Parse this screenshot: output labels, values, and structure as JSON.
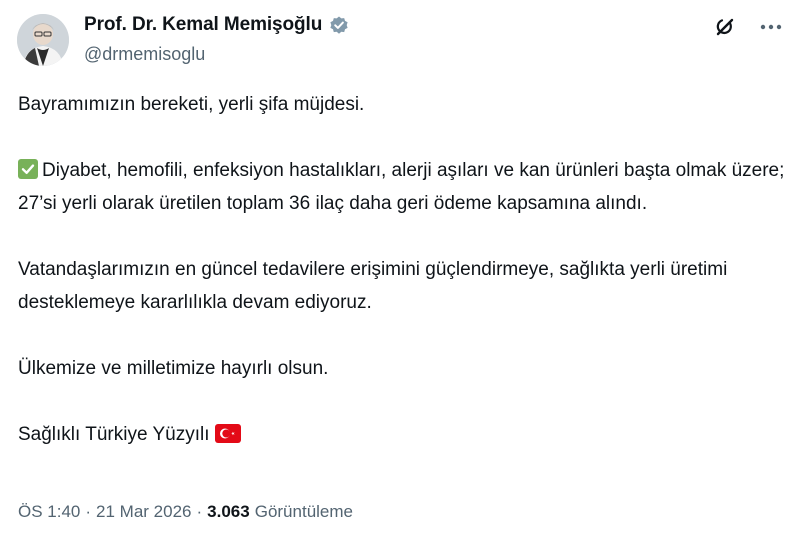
{
  "author": {
    "display_name": "Prof. Dr. Kemal Memişoğlu",
    "handle": "@drmemisoglu",
    "verified": true
  },
  "icons": {
    "avatar": "profile-photo",
    "verified": "verified-badge-icon",
    "grok": "grok-icon",
    "more": "more-options-icon",
    "check": "check-mark-emoji",
    "flag": "turkey-flag-emoji"
  },
  "colors": {
    "verified_badge": "#829aab",
    "text": "#0f1419",
    "secondary_text": "#536471",
    "check_emoji": "#78b159",
    "flag_red": "#e30a17"
  },
  "tweet": {
    "line1": "Bayramımızın bereketi, yerli şifa müjdesi.",
    "line2": "Diyabet, hemofili, enfeksiyon hastalıkları, alerji aşıları ve kan ürünleri başta olmak üzere; 27’si yerli olarak üretilen toplam 36 ilaç daha geri ödeme kapsamına alındı.",
    "line3": "Vatandaşlarımızın en güncel tedavilere erişimini güçlendirmeye, sağlıkta yerli üretimi desteklemeye kararlılıkla devam ediyoruz.",
    "line4": "Ülkemize ve milletimize hayırlı olsun.",
    "line5": "Sağlıklı Türkiye Yüzyılı"
  },
  "meta": {
    "time": "ÖS 1:40",
    "separator": "·",
    "date": "21 Mar 2026",
    "views_count": "3.063",
    "views_label": "Görüntüleme"
  }
}
